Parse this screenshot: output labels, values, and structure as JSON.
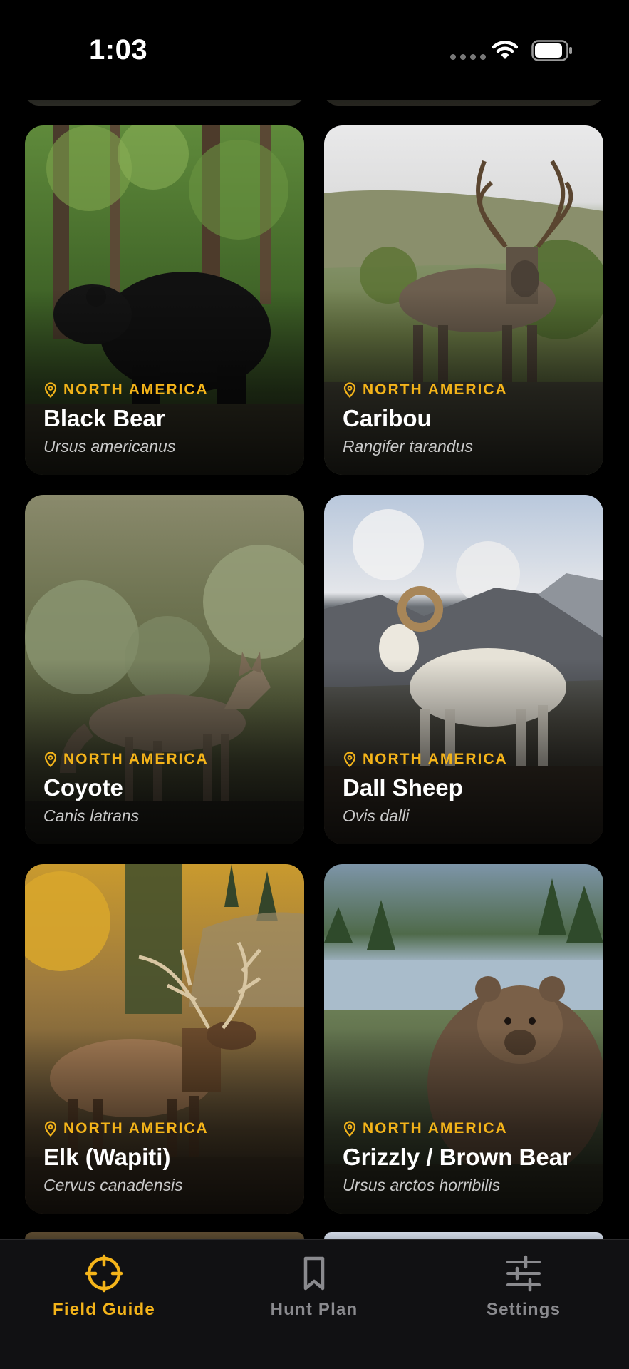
{
  "status_bar": {
    "time": "1:03"
  },
  "cards": [
    {
      "region": "NORTH AMERICA",
      "name": "Black Bear",
      "scientific": "Ursus americanus"
    },
    {
      "region": "NORTH AMERICA",
      "name": "Caribou",
      "scientific": "Rangifer tarandus"
    },
    {
      "region": "NORTH AMERICA",
      "name": "Coyote",
      "scientific": "Canis latrans"
    },
    {
      "region": "NORTH AMERICA",
      "name": "Dall Sheep",
      "scientific": "Ovis dalli"
    },
    {
      "region": "NORTH AMERICA",
      "name": "Elk (Wapiti)",
      "scientific": "Cervus canadensis"
    },
    {
      "region": "NORTH AMERICA",
      "name": "Grizzly / Brown Bear",
      "scientific": "Ursus arctos horribilis"
    }
  ],
  "tabs": [
    {
      "label": "Field Guide",
      "icon": "crosshair-icon",
      "active": true
    },
    {
      "label": "Hunt Plan",
      "icon": "bookmark-icon",
      "active": false
    },
    {
      "label": "Settings",
      "icon": "sliders-icon",
      "active": false
    }
  ],
  "colors": {
    "accent": "#f4b41a",
    "inactive": "#8a8a8e",
    "background": "#000000",
    "tab_bar": "#111113"
  }
}
